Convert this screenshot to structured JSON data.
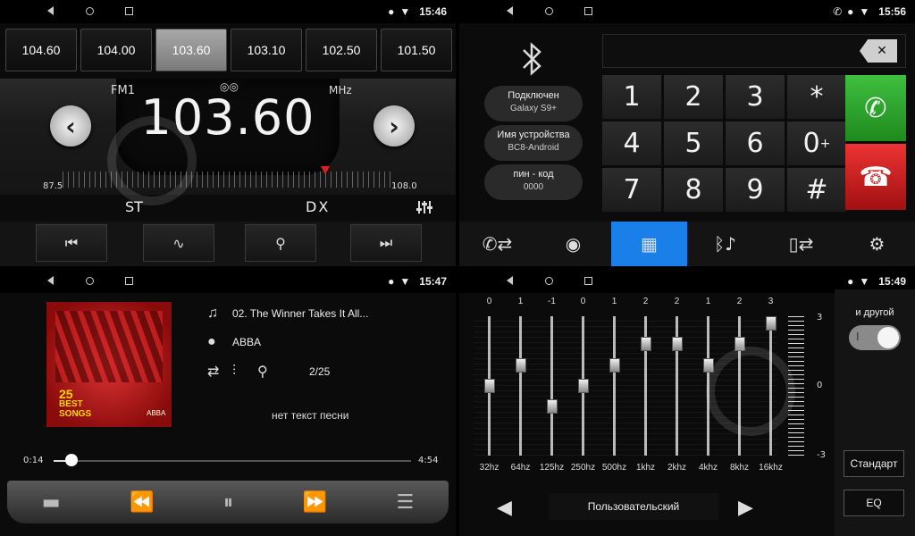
{
  "status": {
    "q1_time": "15:46",
    "q2_time": "15:56",
    "q3_time": "15:47",
    "q4_time": "15:49"
  },
  "radio": {
    "presets": [
      "104.60",
      "104.00",
      "103.60",
      "103.10",
      "102.50",
      "101.50"
    ],
    "active_preset": 2,
    "band": "FM1",
    "unit": "MHz",
    "freq": "103.60",
    "scale_min": "87.5",
    "scale_max": "108.0",
    "tuned_fraction": 0.78,
    "st": "ST",
    "dx": "DX",
    "prev_label": "‹",
    "next_label": "›"
  },
  "phone": {
    "pill1_a": "Подключен",
    "pill1_b": "Galaxy S9+",
    "pill2_a": "Имя устройства",
    "pill2_b": "BC8-Android",
    "pill3_a": "пин - код",
    "pill3_b": "0000",
    "keys": [
      "1",
      "2",
      "3",
      "*",
      "4",
      "5",
      "6",
      "0",
      "7",
      "8",
      "9",
      "#"
    ],
    "zero_plus": "+"
  },
  "music": {
    "track": "02. The Winner Takes It All...",
    "artist": "ABBA",
    "counter": "2/25",
    "lyrics": "нет текст песни",
    "time_current": "0:14",
    "time_total": "4:54",
    "progress_fraction": 0.05,
    "album_text": [
      "25",
      "BEST",
      "SONGS"
    ],
    "album_artist": "ABBA"
  },
  "eq": {
    "values": [
      "0",
      "1",
      "-1",
      "0",
      "1",
      "2",
      "2",
      "1",
      "2",
      "3"
    ],
    "freqs": [
      "32hz",
      "64hz",
      "125hz",
      "250hz",
      "500hz",
      "1khz",
      "2khz",
      "4khz",
      "8khz",
      "16khz"
    ],
    "levels": [
      0,
      1,
      -1,
      0,
      1,
      2,
      2,
      1,
      2,
      3
    ],
    "meter_labels": [
      "3",
      "0",
      "-3"
    ],
    "toggle_label": "и другой",
    "toggle_state": "I",
    "standard": "Стандарт",
    "eq_btn": "EQ",
    "preset": "Пользовательский"
  }
}
